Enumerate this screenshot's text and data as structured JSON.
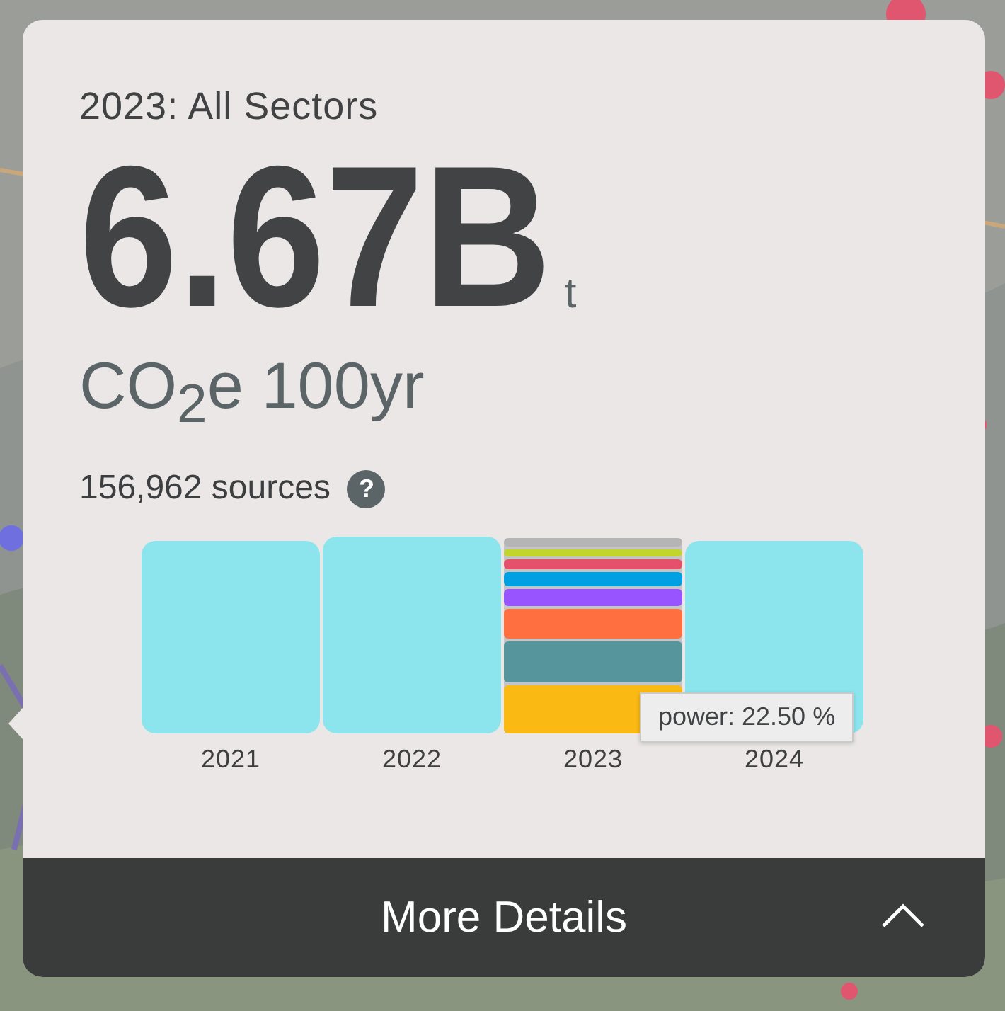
{
  "panel": {
    "title": "2023: All Sectors",
    "value": "6.67B",
    "unit": "t",
    "measure": "CO$_{2}$e 100yr",
    "sources": "156,962 sources",
    "help": "?"
  },
  "chart": {
    "bars": [
      {
        "label": "2021",
        "segments": [
          {
            "color": "#8ce4ec"
          }
        ]
      },
      {
        "label": "2022",
        "segments": [
          {
            "color": "#8ce4ec"
          }
        ]
      },
      {
        "label": "2023",
        "segments": [
          {
            "color": "#fbb913"
          },
          {
            "color": "#57959d"
          },
          {
            "color": "#ff6f3f"
          },
          {
            "color": "#9855ff"
          },
          {
            "color": "#00a0e3"
          },
          {
            "color": "#e5506a"
          },
          {
            "color": "#c2d52c"
          },
          {
            "color": "#b5b5b5"
          }
        ]
      },
      {
        "label": "2024",
        "segments": [
          {
            "color": "#8ce4ec"
          }
        ]
      }
    ],
    "tooltip": "power: 22.50 %"
  },
  "footer": {
    "button": "More Details"
  }
}
